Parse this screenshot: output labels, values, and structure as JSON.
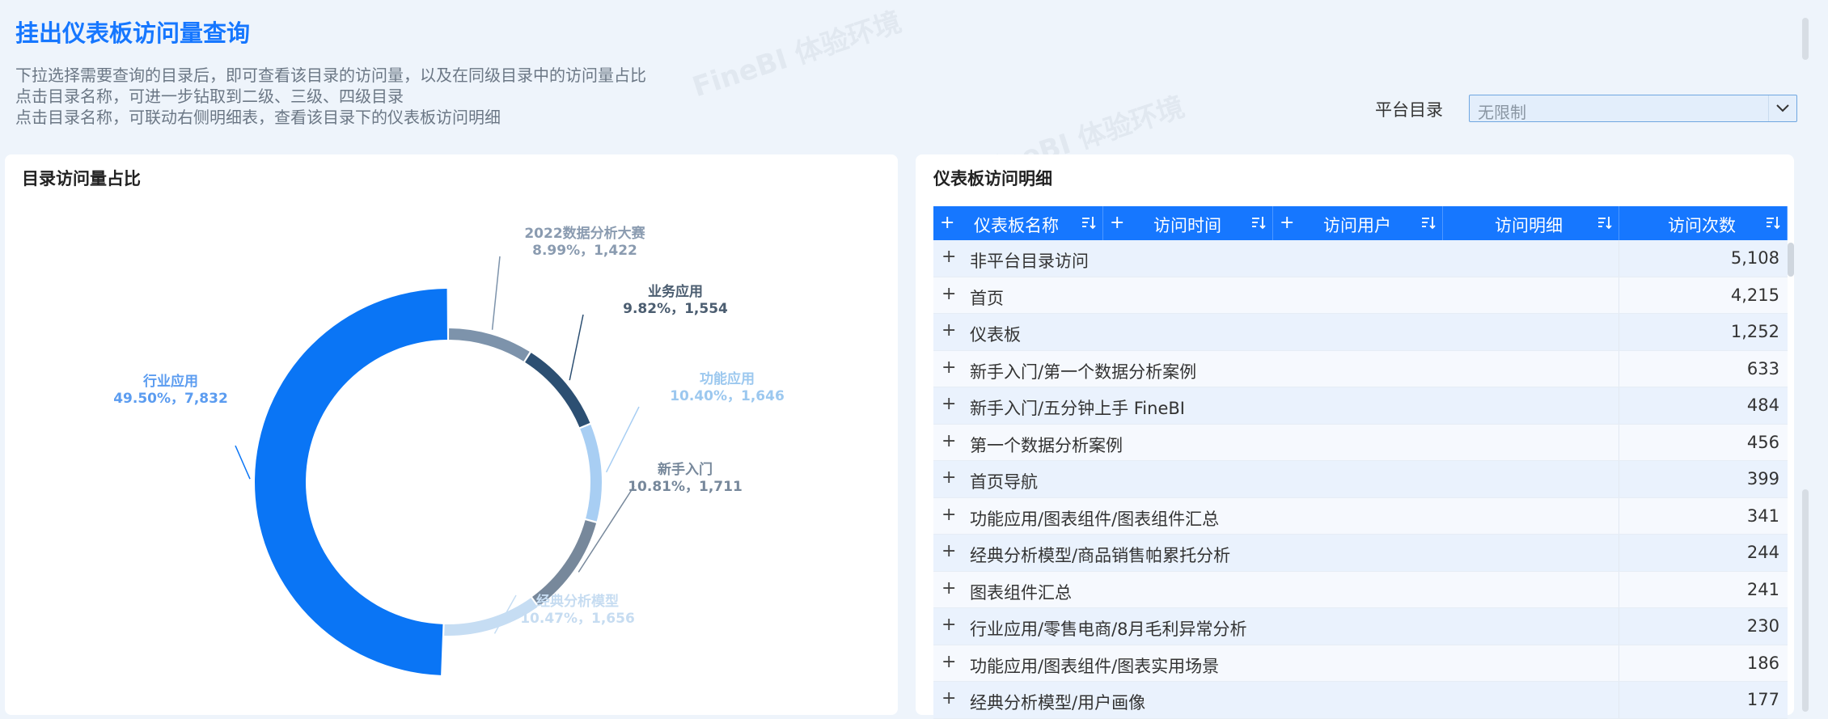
{
  "header": {
    "title": "挂出仪表板访问量查询",
    "desc": [
      "下拉选择需要查询的目录后，即可查看该目录的访问量，以及在同级目录中的访问量占比",
      "点击目录名称，可进一步钻取到二级、三级、四级目录",
      "点击目录名称，可联动右侧明细表，查看该目录下的仪表板访问明细"
    ]
  },
  "filter": {
    "label": "平台目录",
    "value": "无限制"
  },
  "watermark": "FineBI 体验环境",
  "left_card": {
    "title": "目录访问量占比"
  },
  "chart_data": {
    "type": "pie",
    "title": "目录访问量占比",
    "slices": [
      {
        "name": "2022数据分析大赛",
        "percent": "8.99%",
        "value": 1422,
        "label": "8.99%，1,422",
        "color": "#7d93ab"
      },
      {
        "name": "业务应用",
        "percent": "9.82%",
        "value": 1554,
        "label": "9.82%，1,554",
        "color": "#2c4f72"
      },
      {
        "name": "功能应用",
        "percent": "10.40%",
        "value": 1646,
        "label": "10.40%，1,646",
        "color": "#a8cef3"
      },
      {
        "name": "新手入门",
        "percent": "10.81%",
        "value": 1711,
        "label": "10.81%，1,711",
        "color": "#77889b"
      },
      {
        "name": "经典分析模型",
        "percent": "10.47%",
        "value": 1656,
        "label": "10.47%，1,656",
        "color": "#c6ddf3"
      },
      {
        "name": "行业应用",
        "percent": "49.50%",
        "value": 7832,
        "label": "49.50%，7,832",
        "color": "#0a75f5"
      }
    ]
  },
  "right_card": {
    "title": "仪表板访问明细",
    "columns": [
      {
        "label": "仪表板名称",
        "plus": "+",
        "sort": true
      },
      {
        "label": "访问时间",
        "plus": "+",
        "sort": true
      },
      {
        "label": "访问用户",
        "plus": "+",
        "sort": true
      },
      {
        "label": "访问明细",
        "plus": "",
        "sort": true
      },
      {
        "label": "访问次数",
        "plus": "",
        "sort": true
      }
    ],
    "rows": [
      {
        "name": "非平台目录访问",
        "count": "5,108"
      },
      {
        "name": "首页",
        "count": "4,215"
      },
      {
        "name": "仪表板",
        "count": "1,252"
      },
      {
        "name": "新手入门/第一个数据分析案例",
        "count": "633"
      },
      {
        "name": "新手入门/五分钟上手 FineBI",
        "count": "484"
      },
      {
        "name": "第一个数据分析案例",
        "count": "456"
      },
      {
        "name": "首页导航",
        "count": "399"
      },
      {
        "name": "功能应用/图表组件/图表组件汇总",
        "count": "341"
      },
      {
        "name": "经典分析模型/商品销售帕累托分析",
        "count": "244"
      },
      {
        "name": "图表组件汇总",
        "count": "241"
      },
      {
        "name": "行业应用/零售电商/8月毛利异常分析",
        "count": "230"
      },
      {
        "name": "功能应用/图表组件/图表实用场景",
        "count": "186"
      },
      {
        "name": "经典分析模型/用户画像",
        "count": "177"
      }
    ]
  }
}
